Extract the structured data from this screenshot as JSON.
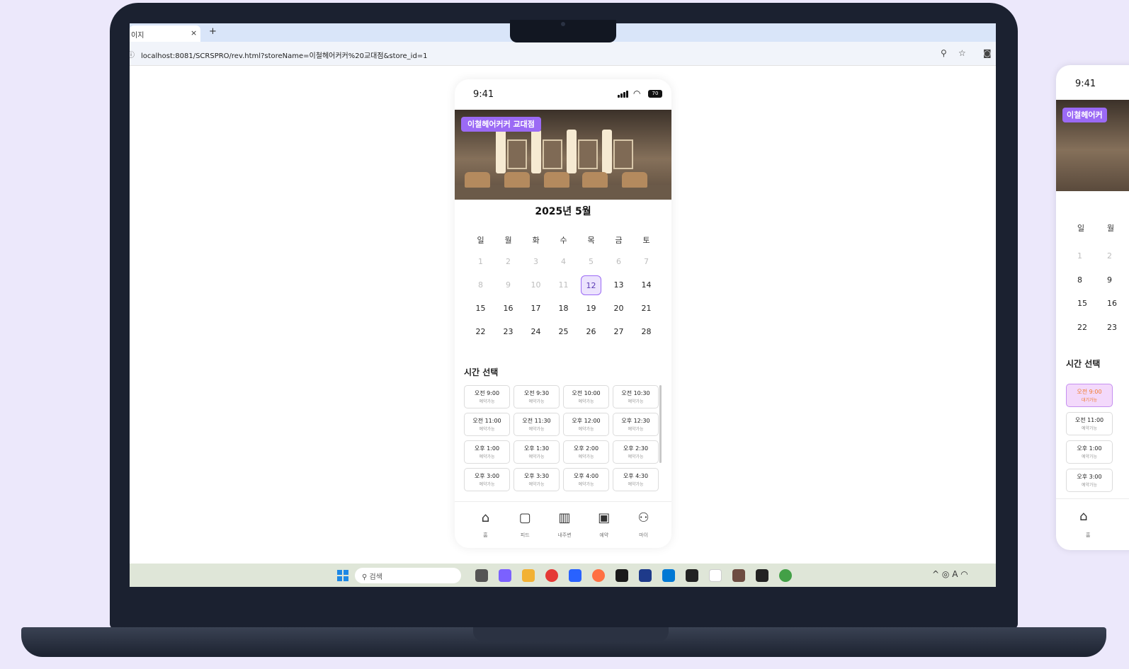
{
  "browser": {
    "tab_title": "이지",
    "tab_close": "×",
    "new_tab": "+",
    "url": "localhost:8081/SCRSPRO/rev.html?storeName=이철헤어커커%20교대점&store_id=1",
    "icons": [
      "info-icon",
      "zoom-icon",
      "star-icon",
      "camera-icon"
    ]
  },
  "phone": {
    "status_time": "9:41",
    "battery": "70",
    "store_badge": "이철헤어커커 교대점",
    "month_title": "2025년 5월",
    "weekdays": [
      "일",
      "월",
      "화",
      "수",
      "목",
      "금",
      "토"
    ],
    "calendar_rows": [
      [
        "1",
        "2",
        "3",
        "4",
        "5",
        "6",
        "7"
      ],
      [
        "8",
        "9",
        "10",
        "11",
        "12",
        "13",
        "14"
      ],
      [
        "15",
        "16",
        "17",
        "18",
        "19",
        "20",
        "21"
      ],
      [
        "22",
        "23",
        "24",
        "25",
        "26",
        "27",
        "28"
      ]
    ],
    "selected_date": "12",
    "time_section_title": "시간 선택",
    "slots": [
      {
        "time": "오전 9:00",
        "status": "예약가능"
      },
      {
        "time": "오전 9:30",
        "status": "예약가능"
      },
      {
        "time": "오전 10:00",
        "status": "예약가능"
      },
      {
        "time": "오전 10:30",
        "status": "예약가능"
      },
      {
        "time": "오전 11:00",
        "status": "예약가능"
      },
      {
        "time": "오전 11:30",
        "status": "예약가능"
      },
      {
        "time": "오후 12:00",
        "status": "예약가능"
      },
      {
        "time": "오후 12:30",
        "status": "예약가능"
      },
      {
        "time": "오후 1:00",
        "status": "예약가능"
      },
      {
        "time": "오후 1:30",
        "status": "예약가능"
      },
      {
        "time": "오후 2:00",
        "status": "예약가능"
      },
      {
        "time": "오후 2:30",
        "status": "예약가능"
      },
      {
        "time": "오후 3:00",
        "status": "예약가능"
      },
      {
        "time": "오후 3:30",
        "status": "예약가능"
      },
      {
        "time": "오후 4:00",
        "status": "예약가능"
      },
      {
        "time": "오후 4:30",
        "status": "예약가능"
      }
    ],
    "nav": [
      {
        "label": "홈",
        "icon": "home-icon"
      },
      {
        "label": "피드",
        "icon": "feed-icon"
      },
      {
        "label": "내주변",
        "icon": "map-icon"
      },
      {
        "label": "예약",
        "icon": "calendar-icon"
      },
      {
        "label": "마이",
        "icon": "user-icon"
      }
    ]
  },
  "taskbar": {
    "search_label": "검색",
    "tray_icons": [
      "chevron-up-icon",
      "eye-off-icon",
      "font-icon",
      "wifi-icon"
    ]
  },
  "phone2": {
    "status_time": "9:41",
    "store_badge": "이철헤어커",
    "weekday_1": "일",
    "weekday_2": "월",
    "dates_col1": [
      "1",
      "8",
      "15",
      "22"
    ],
    "dates_col2": [
      "2",
      "9",
      "16",
      "23"
    ],
    "time_section_title": "시간 선택",
    "slots": [
      {
        "time": "오전 9:00",
        "status": "대기가능"
      },
      {
        "time": "오전 11:00",
        "status": "예약가능"
      },
      {
        "time": "오후 1:00",
        "status": "예약가능"
      },
      {
        "time": "오후 3:00",
        "status": "예약가능"
      }
    ],
    "nav_label": "홈"
  },
  "colors": {
    "accent": "#9b6af5",
    "background": "#ece8fb",
    "selected_bg": "#ece3fd",
    "waiting_text": "#f07a2a"
  }
}
